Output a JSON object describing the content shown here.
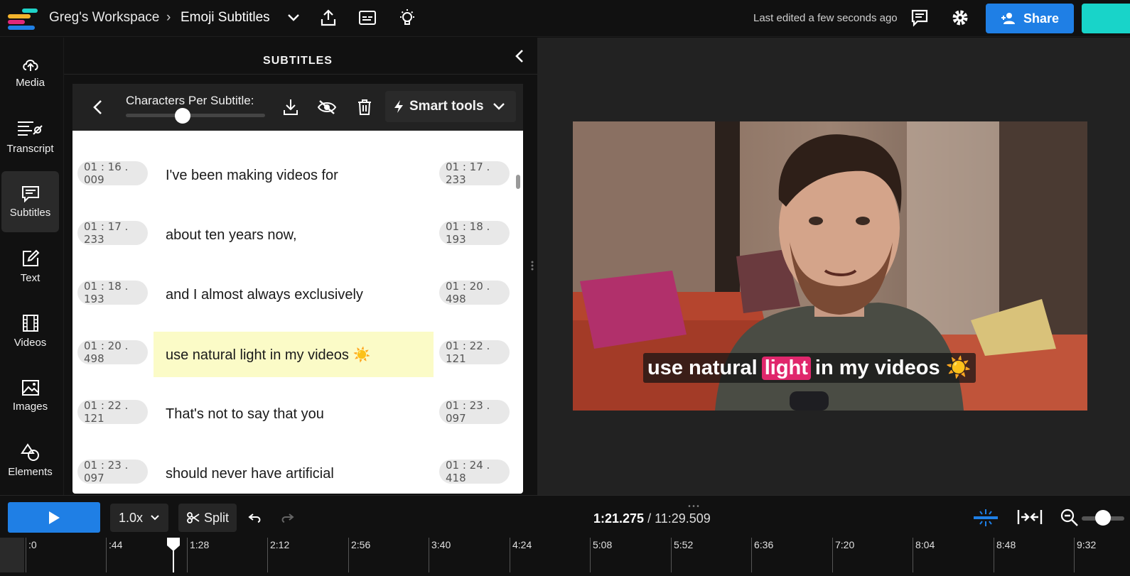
{
  "topbar": {
    "workspace": "Greg's Workspace",
    "separator": "›",
    "project": "Emoji Subtitles",
    "last_edited": "Last edited a few seconds ago",
    "share_label": "Share",
    "logo_colors": [
      "#1fd4c9",
      "#f4b42c",
      "#e0277a",
      "#1f7fe5"
    ]
  },
  "rail": {
    "items": [
      {
        "label": "Media",
        "icon": "upload-cloud-icon"
      },
      {
        "label": "Transcript",
        "icon": "transcript-icon"
      },
      {
        "label": "Subtitles",
        "icon": "subtitles-icon",
        "active": true
      },
      {
        "label": "Text",
        "icon": "text-edit-icon"
      },
      {
        "label": "Videos",
        "icon": "film-icon"
      },
      {
        "label": "Images",
        "icon": "image-icon"
      },
      {
        "label": "Elements",
        "icon": "shapes-icon"
      }
    ]
  },
  "panel": {
    "title": "SUBTITLES",
    "cps_label": "Characters Per Subtitle:",
    "cps_value": 0.41,
    "smart_tools_label": "Smart tools"
  },
  "subtitles": [
    {
      "start": "01 : 16 . 009",
      "text": "I've been making videos for",
      "end": "01 : 17 . 233"
    },
    {
      "start": "01 : 17 . 233",
      "text": "about ten years now,",
      "end": "01 : 18 . 193"
    },
    {
      "start": "01 : 18 . 193",
      "text": "and I almost always exclusively",
      "end": "01 : 20 . 498"
    },
    {
      "start": "01 : 20 . 498",
      "text": "use natural light in my videos ☀️",
      "end": "01 : 22 . 121",
      "active": true
    },
    {
      "start": "01 : 22 . 121",
      "text": "That's not to say that you",
      "end": "01 : 23 . 097"
    },
    {
      "start": "01 : 23 . 097",
      "text": "should never have artificial",
      "end": "01 : 24 . 418"
    }
  ],
  "preview": {
    "caption_before": "use natural",
    "caption_highlight": "light",
    "caption_after": "in my videos ☀️",
    "highlight_color": "#e0276c"
  },
  "playback": {
    "speed": "1.0x",
    "split_label": "Split",
    "current_time": "1:21.275",
    "separator": " / ",
    "total_time": "11:29.509",
    "zoom_level": 0.35
  },
  "timeline": {
    "ticks": [
      ":0",
      ":44",
      "1:28",
      "2:12",
      "2:56",
      "3:40",
      "4:24",
      "5:08",
      "5:52",
      "6:36",
      "7:20",
      "8:04",
      "8:48",
      "9:32"
    ]
  }
}
